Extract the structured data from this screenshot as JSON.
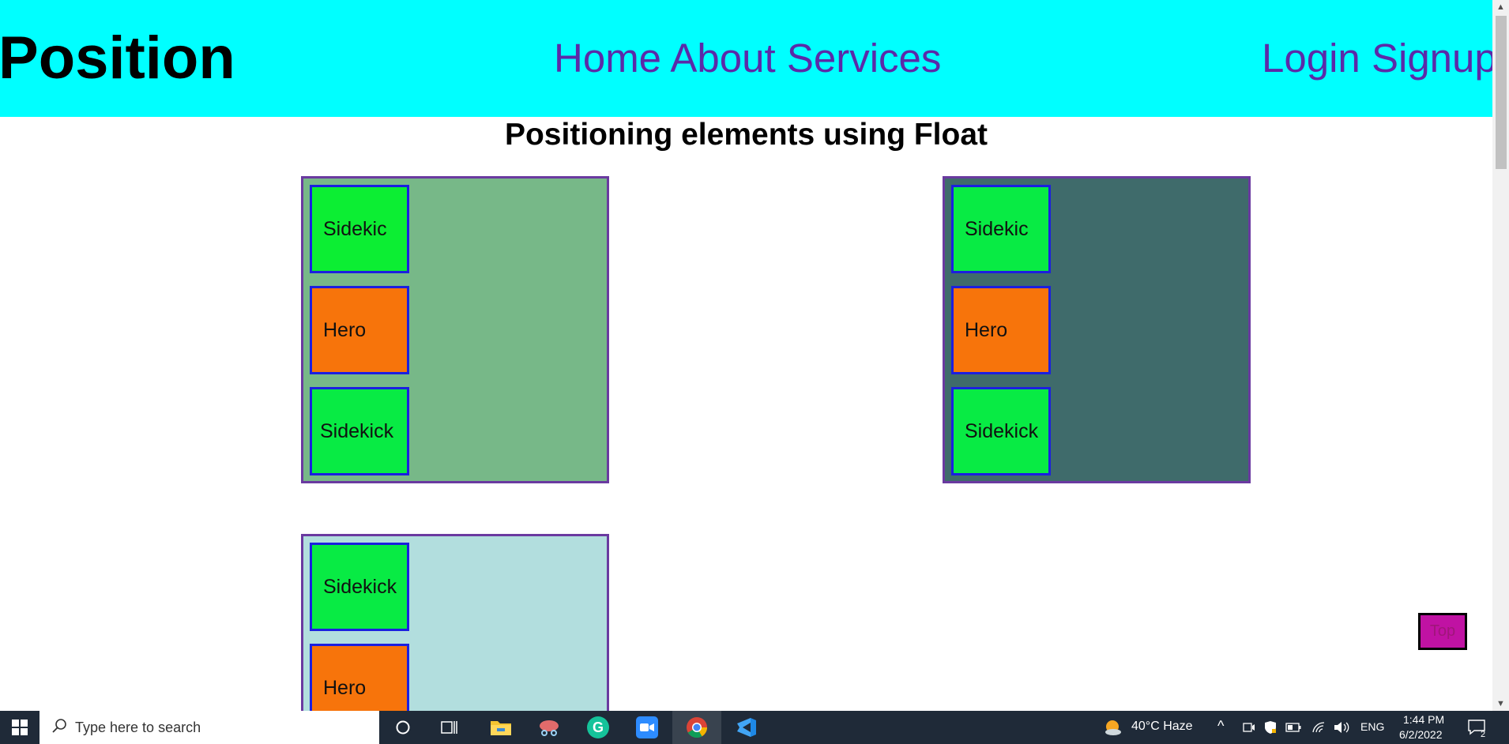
{
  "navbar": {
    "brand": "Position",
    "center_links": [
      "Home",
      "About",
      "Services"
    ],
    "right_links": [
      "Login",
      "Signup"
    ],
    "background": "#00ffff"
  },
  "heading": "Positioning elements using Float",
  "containers": [
    {
      "background": "#77b888",
      "boxes": [
        "Sidekic",
        "Hero",
        "Sidekick"
      ]
    },
    {
      "background": "#3f6b6b",
      "boxes": [
        "Sidekic",
        "Hero",
        "Sidekick"
      ]
    },
    {
      "background": "#b2dede",
      "boxes": [
        "Sidekick",
        "Hero"
      ]
    }
  ],
  "top_button": "Top",
  "taskbar": {
    "search_placeholder": "Type here to search",
    "weather": "40°C  Haze",
    "language": "ENG",
    "time": "1:44 PM",
    "date": "6/2/2022",
    "notification_count": "2",
    "icons": [
      "windows-start-icon",
      "search-icon",
      "cortana-icon",
      "task-view-icon",
      "file-explorer-icon",
      "snip-icon",
      "grammarly-icon",
      "zoom-icon",
      "chrome-icon",
      "vscode-icon"
    ]
  }
}
